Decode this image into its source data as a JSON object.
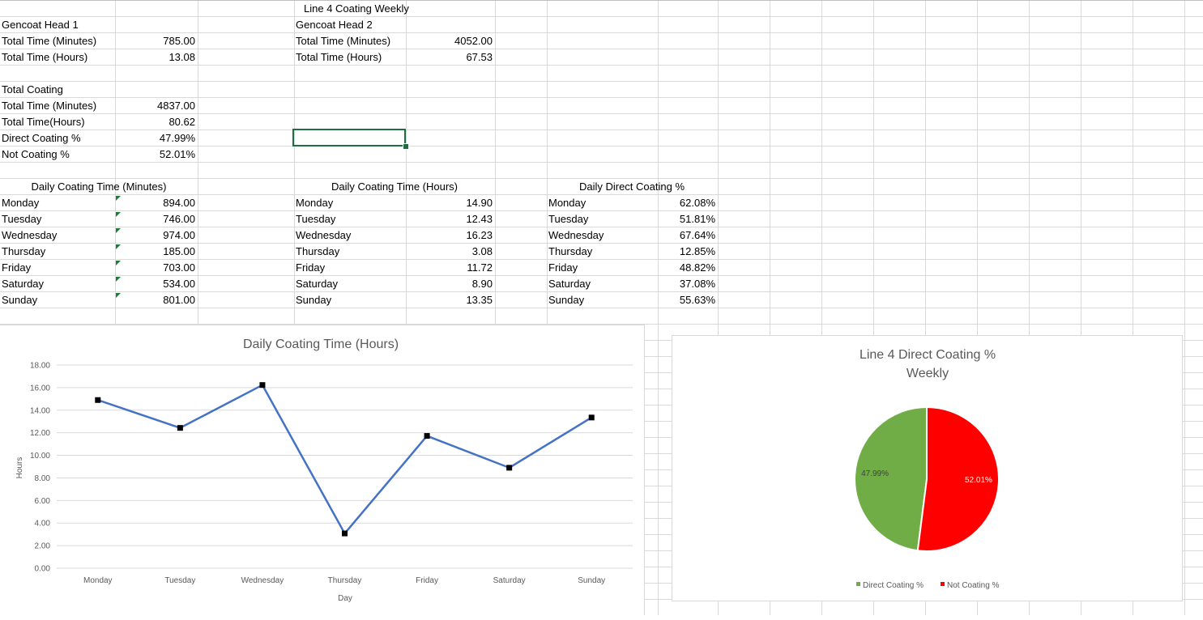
{
  "sheet": {
    "title": "Line 4 Coating Weekly",
    "head1": {
      "label": "Gencoat Head 1",
      "min_label": "Total Time (Minutes)",
      "min": "785.00",
      "hr_label": "Total Time (Hours)",
      "hr": "13.08"
    },
    "head2": {
      "label": "Gencoat Head 2",
      "min_label": "Total Time (Minutes)",
      "min": "4052.00",
      "hr_label": "Total Time (Hours)",
      "hr": "67.53"
    },
    "total": {
      "label": "Total Coating",
      "min_label": "Total Time (Minutes)",
      "min": "4837.00",
      "hr_label": "Total Time(Hours)",
      "hr": "80.62",
      "direct_label": "Direct Coating %",
      "direct": "47.99%",
      "not_label": "Not Coating %",
      "not": "52.01%"
    },
    "daily_minutes": {
      "header": "Daily Coating Time (Minutes)",
      "rows": [
        [
          "Monday",
          "894.00"
        ],
        [
          "Tuesday",
          "746.00"
        ],
        [
          "Wednesday",
          "974.00"
        ],
        [
          "Thursday",
          "185.00"
        ],
        [
          "Friday",
          "703.00"
        ],
        [
          "Saturday",
          "534.00"
        ],
        [
          "Sunday",
          "801.00"
        ]
      ]
    },
    "daily_hours": {
      "header": "Daily Coating Time (Hours)",
      "rows": [
        [
          "Monday",
          "14.90"
        ],
        [
          "Tuesday",
          "12.43"
        ],
        [
          "Wednesday",
          "16.23"
        ],
        [
          "Thursday",
          "3.08"
        ],
        [
          "Friday",
          "11.72"
        ],
        [
          "Saturday",
          "8.90"
        ],
        [
          "Sunday",
          "13.35"
        ]
      ]
    },
    "daily_direct": {
      "header": "Daily Direct Coating %",
      "rows": [
        [
          "Monday",
          "62.08%"
        ],
        [
          "Tuesday",
          "51.81%"
        ],
        [
          "Wednesday",
          "67.64%"
        ],
        [
          "Thursday",
          "12.85%"
        ],
        [
          "Friday",
          "48.82%"
        ],
        [
          "Saturday",
          "37.08%"
        ],
        [
          "Sunday",
          "55.63%"
        ]
      ]
    }
  },
  "chart_data": [
    {
      "type": "line",
      "title": "Daily Coating Time (Hours)",
      "xlabel": "Day",
      "ylabel": "Hours",
      "categories": [
        "Monday",
        "Tuesday",
        "Wednesday",
        "Thursday",
        "Friday",
        "Saturday",
        "Sunday"
      ],
      "values": [
        14.9,
        12.43,
        16.23,
        3.08,
        11.72,
        8.9,
        13.35
      ],
      "yticks": [
        "0.00",
        "2.00",
        "4.00",
        "6.00",
        "8.00",
        "10.00",
        "12.00",
        "14.00",
        "16.00",
        "18.00"
      ],
      "ylim": [
        0,
        18
      ],
      "grid": true,
      "line_color": "#4472C4",
      "marker_color": "#000000"
    },
    {
      "type": "pie",
      "title": "Line 4 Direct Coating % Weekly",
      "title_lines": [
        "Line 4 Direct Coating %",
        "Weekly"
      ],
      "slices": [
        {
          "label": "Direct Coating %",
          "value": 47.99,
          "display": "47.99%",
          "color": "#70AD47"
        },
        {
          "label": "Not Coating %",
          "value": 52.01,
          "display": "52.01%",
          "color": "#FF0000"
        }
      ],
      "legend": "bottom"
    }
  ]
}
